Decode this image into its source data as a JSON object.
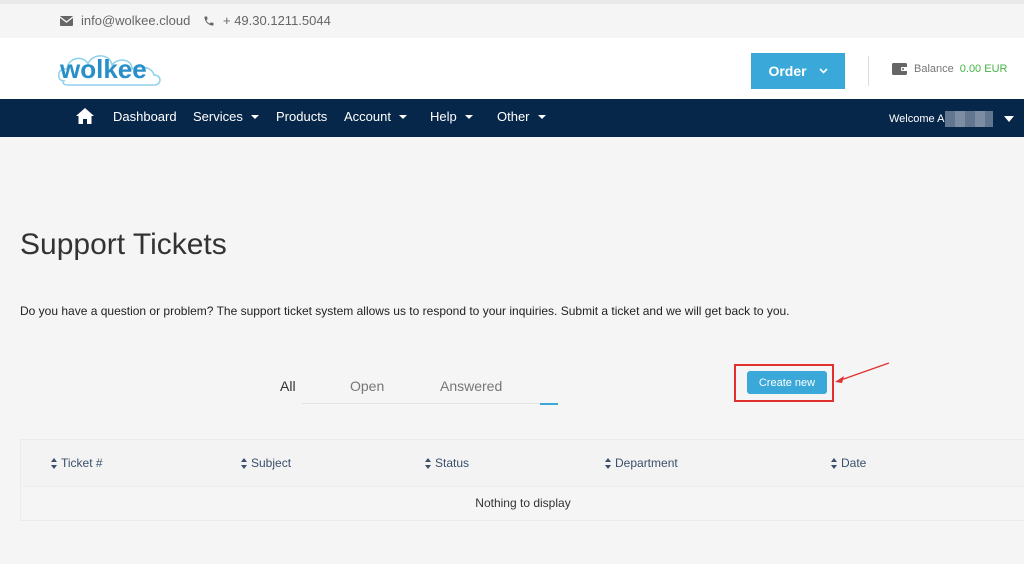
{
  "topbar": {
    "email": "info@wolkee.cloud",
    "phone": "+ 49.30.1211.5044",
    "email_icon": "envelope-icon",
    "phone_icon": "phone-icon"
  },
  "header": {
    "logo_text": "wolkee",
    "order_label": "Order",
    "balance_label": "Balance",
    "balance_amount": "0.00 EUR",
    "wallet_icon": "wallet-icon"
  },
  "nav": {
    "items": [
      {
        "label": "Dashboard"
      },
      {
        "label": "Services"
      },
      {
        "label": "Products"
      },
      {
        "label": "Account"
      },
      {
        "label": "Help"
      },
      {
        "label": "Other"
      }
    ],
    "welcome": "Welcome A"
  },
  "page": {
    "title": "Support Tickets",
    "intro": "Do you have a question or problem? The support ticket system allows us to respond to your inquiries. Submit a ticket and we will get back to you."
  },
  "tabs": [
    {
      "label": "All",
      "active": true
    },
    {
      "label": "Open",
      "active": false
    },
    {
      "label": "Answered",
      "active": false
    }
  ],
  "actions": {
    "create_label": "Create new"
  },
  "table": {
    "columns": [
      "Ticket #",
      "Subject",
      "Status",
      "Department",
      "Date"
    ],
    "empty": "Nothing to display"
  },
  "colors": {
    "accent": "#3aa8d8",
    "nav_bg": "#07274a",
    "balance_green": "#46b446",
    "highlight_red": "#e03030"
  }
}
